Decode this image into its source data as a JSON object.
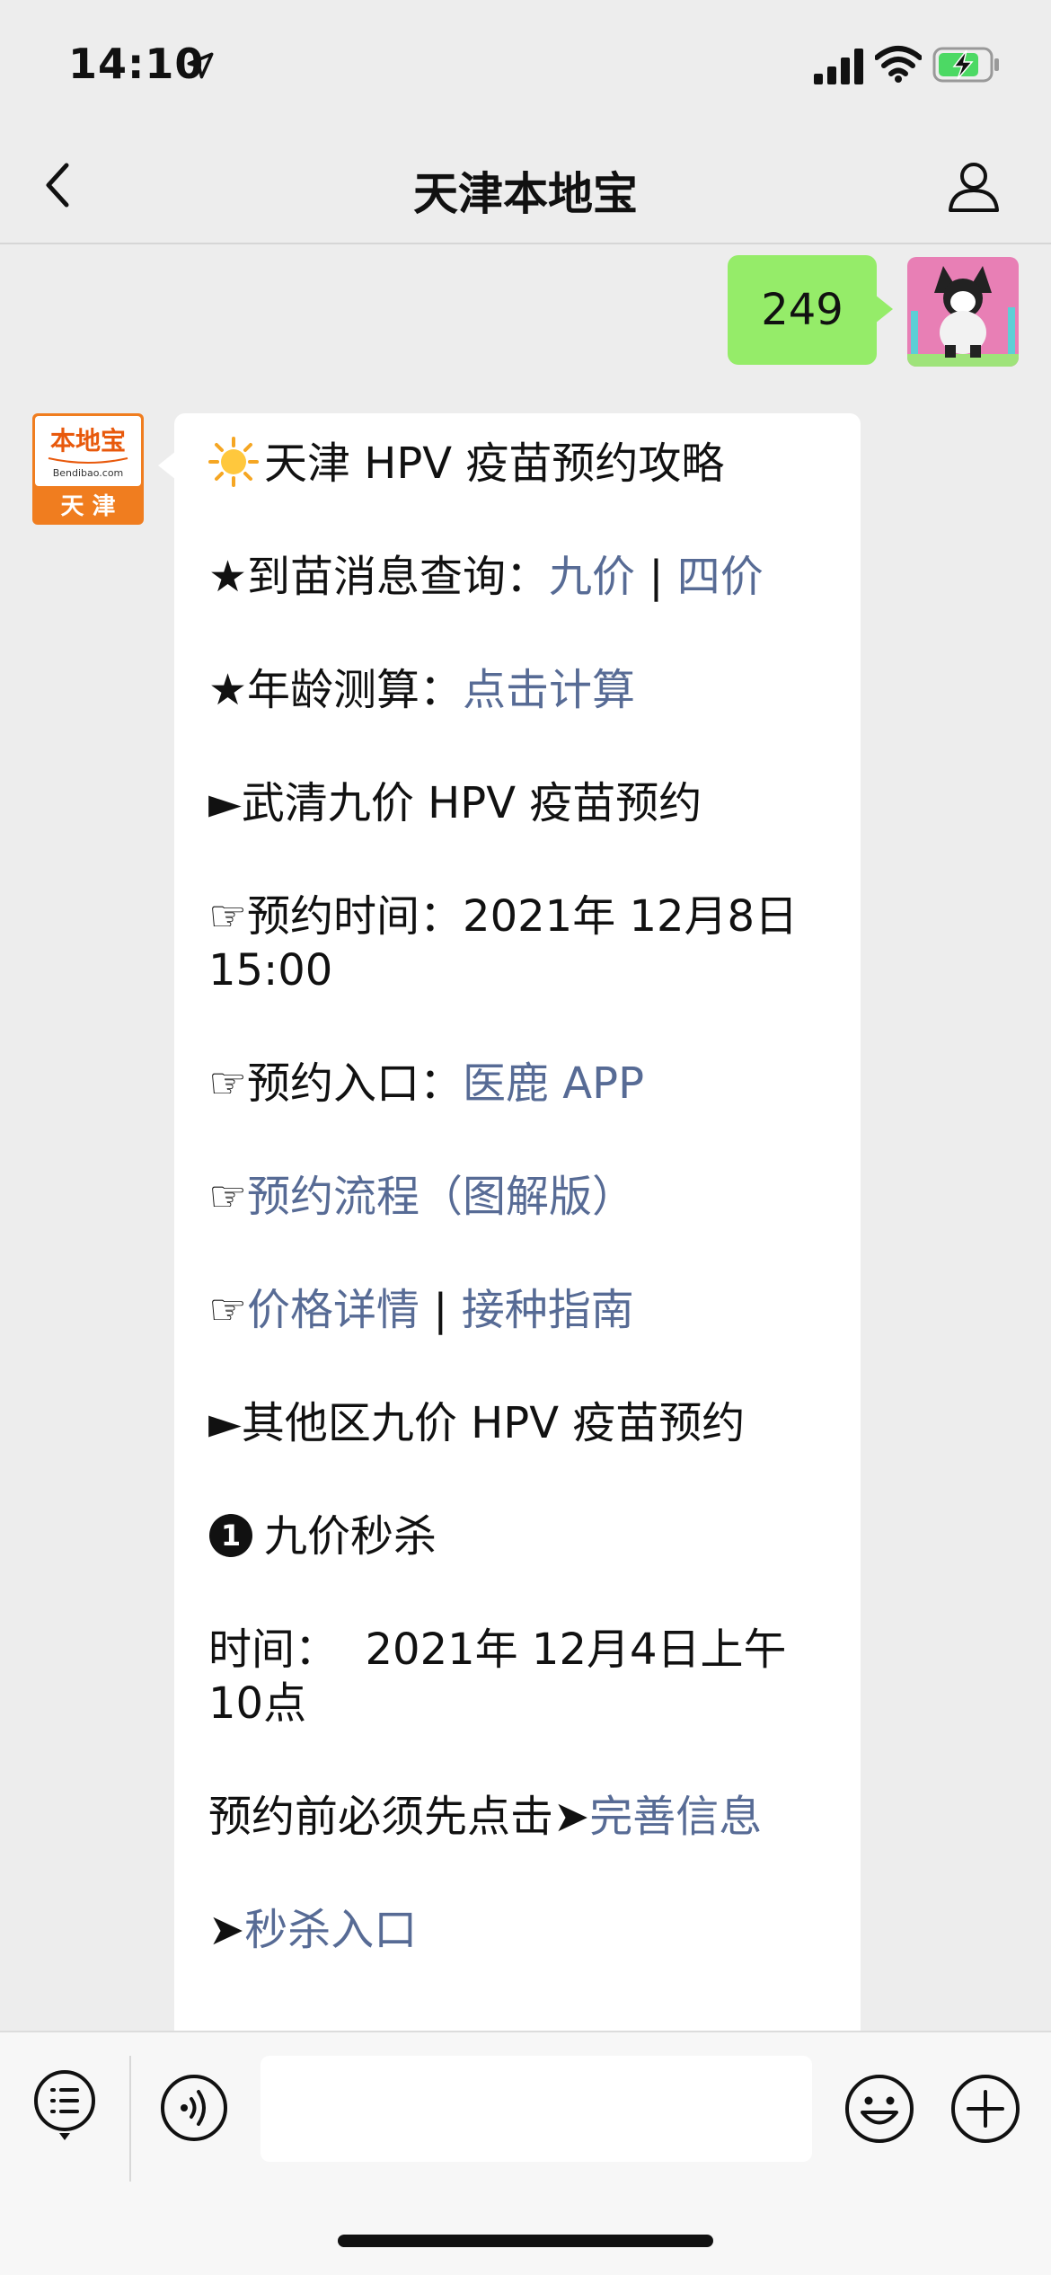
{
  "status_bar": {
    "time": "14:10"
  },
  "nav": {
    "title": "天津本地宝"
  },
  "chat": {
    "outgoing_message": "249",
    "bot_avatar": {
      "top_text": "本地宝",
      "site_text": "Bendibao.com",
      "city_text": "天 津"
    },
    "message": {
      "title": "天津 HPV 疫苗预约攻略",
      "query_label": "★到苗消息查询：",
      "query_link_1": "九价",
      "query_sep": " | ",
      "query_link_2": "四价",
      "age_label": "★年龄测算：",
      "age_link": "点击计算",
      "wuqing_heading": "►武清九价 HPV 疫苗预约",
      "time_text": "☞预约时间：2021年 12月8日 15:00",
      "entry_label": "☞预约入口：",
      "entry_link": "医鹿 APP",
      "process_prefix": "☞",
      "process_link": "预约流程（图解版）",
      "price_prefix": "☞",
      "price_link": "价格详情",
      "price_sep": " | ",
      "guide_link": "接种指南",
      "other_heading": "►其他区九价 HPV 疫苗预约",
      "seckill_label": "九价秒杀",
      "seckill_time": "时间：  2021年 12月4日上午10点",
      "prereq_label": "预约前必须先点击➤",
      "prereq_link": "完善信息",
      "seckill_prefix": "➤",
      "seckill_link": "秒杀入口"
    }
  },
  "input_bar": {
    "placeholder": ""
  },
  "colors": {
    "link": "#576b95",
    "outgoing_bubble": "#95ec69",
    "background": "#ededed",
    "brand_orange": "#f07d1f"
  },
  "icons": [
    "location-arrow-icon",
    "signal-icon",
    "wifi-icon",
    "battery-charging-icon",
    "back-icon",
    "profile-icon",
    "sun-icon",
    "number-one-icon",
    "menu-icon",
    "voice-icon",
    "emoji-icon",
    "plus-icon"
  ]
}
